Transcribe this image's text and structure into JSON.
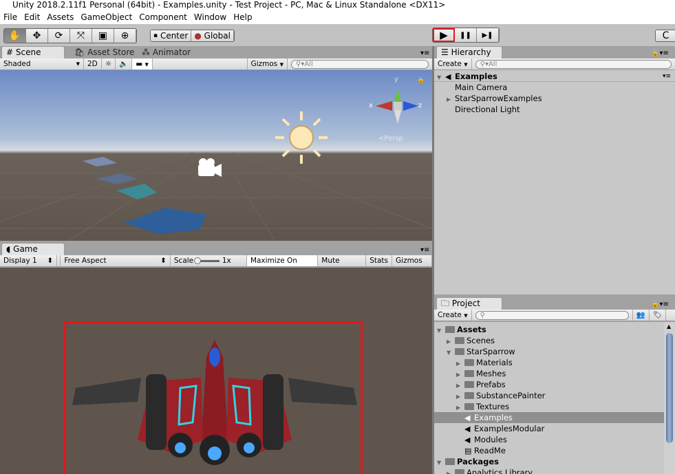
{
  "window": {
    "title": "Unity 2018.2.11f1 Personal (64bit) - Examples.unity - Test Project - PC, Mac & Linux Standalone <DX11>"
  },
  "menu": [
    "File",
    "Edit",
    "Assets",
    "GameObject",
    "Component",
    "Window",
    "Help"
  ],
  "toolbar": {
    "tools": [
      "hand-tool",
      "move-tool",
      "rotate-tool",
      "scale-tool",
      "rect-tool",
      "transform-tool"
    ],
    "pivot": "Center",
    "space": "Global",
    "play": "▶",
    "pause": "❚❚",
    "step": "▶❚",
    "collab": "C"
  },
  "scene": {
    "tabs": [
      "Scene",
      "Asset Store",
      "Animator"
    ],
    "shading": "Shaded",
    "mode2d": "2D",
    "gizmos": "Gizmos",
    "search": "All",
    "persp": "Persp",
    "axes": {
      "x": "x",
      "y": "y",
      "z": "z"
    }
  },
  "game": {
    "tab": "Game",
    "display": "Display 1",
    "aspect": "Free Aspect",
    "scale_label": "Scale",
    "scale_value": "1x",
    "maximize": "Maximize On Play",
    "mute": "Mute Audio",
    "stats": "Stats",
    "gizmos": "Gizmos"
  },
  "hierarchy": {
    "tab": "Hierarchy",
    "create": "Create",
    "search": "All",
    "scene": "Examples",
    "items": [
      "Main Camera",
      "StarSparrowExamples",
      "Directional Light"
    ]
  },
  "project": {
    "tab": "Project",
    "create": "Create",
    "items": [
      {
        "label": "Assets",
        "type": "folder",
        "depth": 0,
        "expanded": true,
        "bold": true
      },
      {
        "label": "Scenes",
        "type": "folder",
        "depth": 1
      },
      {
        "label": "StarSparrow",
        "type": "folder",
        "depth": 1,
        "expanded": true
      },
      {
        "label": "Materials",
        "type": "folder",
        "depth": 2
      },
      {
        "label": "Meshes",
        "type": "folder",
        "depth": 2
      },
      {
        "label": "Prefabs",
        "type": "folder",
        "depth": 2
      },
      {
        "label": "SubstancePainter",
        "type": "folder",
        "depth": 2
      },
      {
        "label": "Textures",
        "type": "folder",
        "depth": 2
      },
      {
        "label": "Examples",
        "type": "scene",
        "depth": 2,
        "selected": true
      },
      {
        "label": "ExamplesModular",
        "type": "scene",
        "depth": 2
      },
      {
        "label": "Modules",
        "type": "scene",
        "depth": 2
      },
      {
        "label": "ReadMe",
        "type": "text",
        "depth": 2
      },
      {
        "label": "Packages",
        "type": "folder",
        "depth": 0,
        "expanded": true,
        "bold": true
      },
      {
        "label": "Analytics Library",
        "type": "folder",
        "depth": 1
      }
    ]
  },
  "colors": {
    "highlight": "#e8141c",
    "ground": "#5f554c",
    "panel": "#c2c2c2"
  }
}
